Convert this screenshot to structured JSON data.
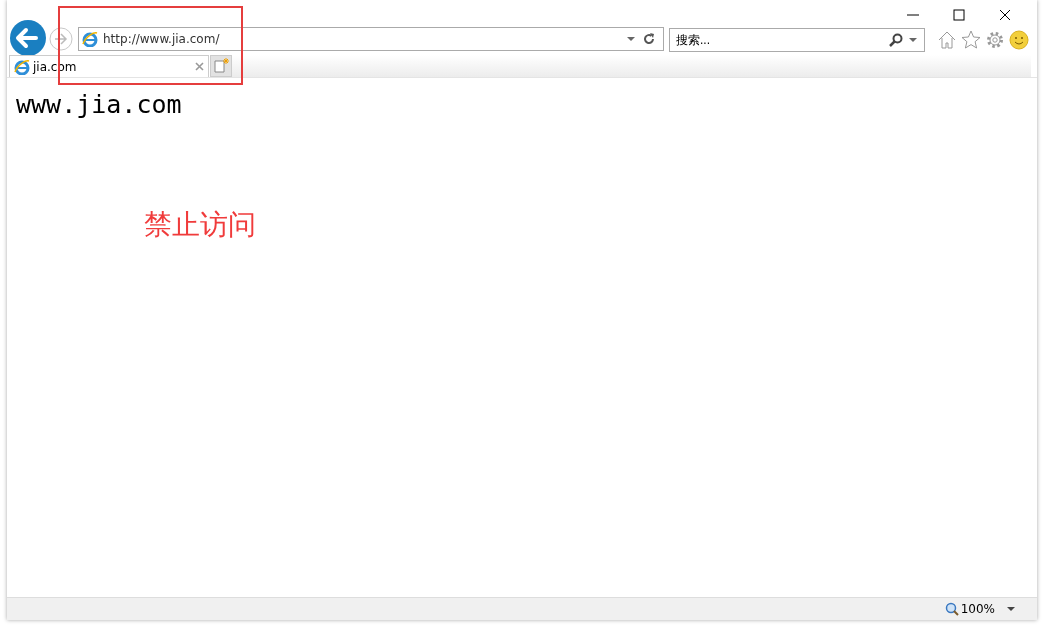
{
  "address": {
    "value": "http://www.jia.com/"
  },
  "search": {
    "placeholder": "搜索..."
  },
  "tabs": [
    {
      "label": "jia.com",
      "selected": true
    }
  ],
  "page": {
    "heading": "www.jia.com"
  },
  "annotation": {
    "text": "禁止访问"
  },
  "status_bar": {
    "zoom": "100%"
  }
}
